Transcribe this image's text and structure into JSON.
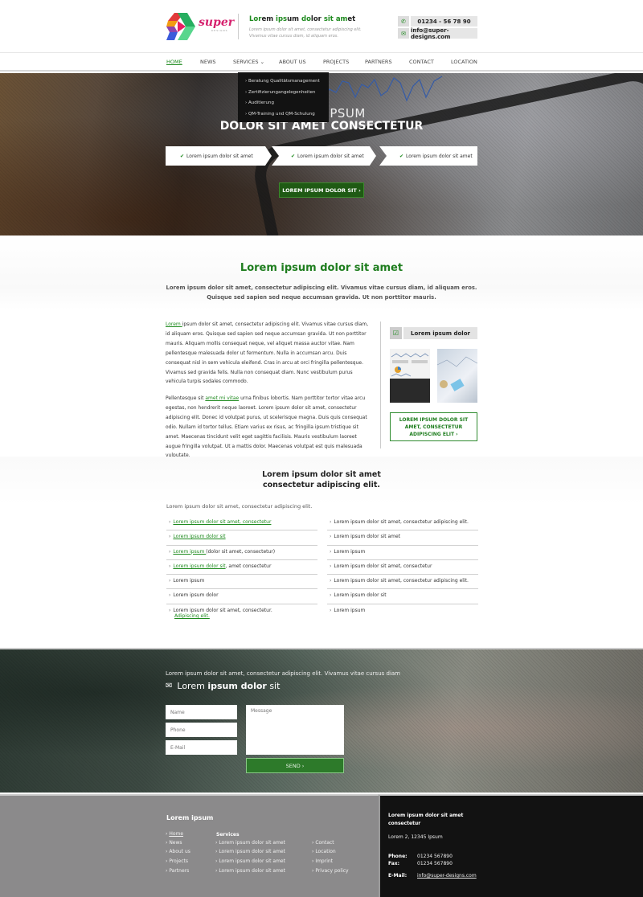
{
  "header": {
    "logo_text": "super",
    "logo_sub": "DESIGNS",
    "title_parts": [
      {
        "text": "Lor",
        "green": true
      },
      {
        "text": "em ",
        "green": false
      },
      {
        "text": "ips",
        "green": true
      },
      {
        "text": "um ",
        "green": false
      },
      {
        "text": "do",
        "green": true
      },
      {
        "text": "lor ",
        "green": false
      },
      {
        "text": "sit am",
        "green": true
      },
      {
        "text": "et",
        "green": false
      }
    ],
    "description": "Lorem ipsum dolor sit amet, consectetur adipiscing elit. Vivamus vitae cursus diam, id aliquam eros.",
    "phone": "01234 - 56 78 90",
    "email": "info@super-designs.com",
    "phone_icon": "phone-icon",
    "email_icon": "envelope-icon"
  },
  "nav": {
    "items": [
      "HOME",
      "NEWS",
      "SERVICES ⌄",
      "ABOUT US",
      "PROJECTS",
      "PARTNERS",
      "CONTACT",
      "LOCATION"
    ],
    "active": "HOME",
    "dropdown": [
      "› Beratung Qualitätsmanagement",
      "› Zertifizierungangelegenheiten",
      "› Auditierung",
      "› QM-Training und QM-Schulung"
    ]
  },
  "hero": {
    "title_line1": "LOREM IPSUM",
    "title_line2": "DOLOR SIT AMET CONSECTETUR",
    "steps": [
      "Lorem ipsum dolor sit amet",
      "Lorem ipsum dolor sit amet",
      "Lorem ipsum dolor sit amet"
    ],
    "check_glyph": "✔",
    "button_label": "LOREM IPSUM DOLOR SIT ›"
  },
  "intro": {
    "title": "Lorem ipsum dolor sit amet",
    "text": "Lorem ipsum dolor sit amet, consectetur adipiscing elit. Vivamus vitae cursus diam, id aliquam eros. Quisque sed sapien sed neque accumsan gravida. Ut non porttitor mauris."
  },
  "article": {
    "p1_link": "Lorem ",
    "p1_text": "ipsum dolor sit amet, consectetur adipiscing elit. Vivamus vitae cursus diam, id aliquam eros. Quisque sed sapien sed neque accumsan gravida. Ut non porttitor mauris. Aliquam mollis consequat neque, vel aliquet massa auctor vitae. Nam pellentesque malesuada dolor ut fermentum. Nulla in accumsan arcu. Duis consequat nisl in sem vehicula eleifend. Cras in arcu at orci fringilla pellentesque. Vivamus sed gravida felis. Nulla non consequat diam. Nunc vestibulum purus vehicula turpis sodales commodo.",
    "p2_before": "Pellentesque sit ",
    "p2_link": "amet mi vitae",
    "p2_after": " urna finibus lobortis. Nam porttitor tortor vitae arcu egestas, non hendrerit neque laoreet. Lorem ipsum dolor sit amet, consectetur adipiscing elit. Donec id volutpat purus, ut scelerisque magna. Duis quis consequat odio. Nullam id tortor tellus. Etiam varius ex risus, ac fringilla ipsum tristique sit amet. Maecenas tincidunt velit eget sagittis facilisis. Mauris vestibulum laoreet augue fringilla volutpat. Ut a mattis dolor. Maecenas volutpat est quis malesuada vulputate."
  },
  "sidebar": {
    "heading": "Lorem ipsum dolor",
    "check_glyph": "☑",
    "button_label": "LOREM IPSUM DOLOR SIT AMET, CONSECTETUR ADIPISCING ELIT ›"
  },
  "list_section": {
    "title_line1": "Lorem ipsum dolor sit amet",
    "title_line2": "consectetur adipiscing elit.",
    "intro": "Lorem ipsum dolor sit amet, consectetur adipiscing elit.",
    "left": [
      {
        "link": "Lorem ipsum dolor sit amet, consectetur",
        "text": ""
      },
      {
        "link": "Lorem ipsum dolor sit",
        "text": ""
      },
      {
        "link": "Lorem ipsum ",
        "text": " (dolor sit amet, consectetur)"
      },
      {
        "link": "Lorem ipsum dolor sit",
        "text": ", amet consectetur"
      },
      {
        "link": "",
        "text": "Lorem ipsum"
      },
      {
        "link": "",
        "text": "Lorem ipsum dolor"
      },
      {
        "link": "",
        "text": "Lorem ipsum dolor sit amet, consectetur.",
        "link2": "Adipiscing elit."
      }
    ],
    "right": [
      "Lorem ipsum dolor sit amet, consectetur adipiscing elit.",
      "Lorem ipsum dolor sit amet",
      "Lorem ipsum",
      "Lorem ipsum dolor sit amet, consectetur",
      "Lorem ipsum dolor sit amet, consectetur adipiscing elit.",
      "Lorem ipsum dolor sit",
      "Lorem ipsum"
    ]
  },
  "contact": {
    "lead": "Lorem ipsum dolor sit amet, consectetur adipiscing elit. Vivamus vitae cursus diam",
    "title_pre": "Lorem ",
    "title_bold": "ipsum dolor",
    "title_post": " sit",
    "name_placeholder": "Name",
    "phone_placeholder": "Phone",
    "email_placeholder": "E-Mail",
    "message_placeholder": "Message",
    "send_label": "SEND ›"
  },
  "footer": {
    "title": "Lorem ipsum",
    "nav": [
      "Home",
      "News",
      "About us",
      "Projects",
      "Partners"
    ],
    "services_heading": "Services",
    "services": [
      "Lorem ipsum dolor sit amet",
      "Lorem ipsum dolor sit amet",
      "Lorem ipsum dolor sit amet",
      "Lorem ipsum dolor sit amet"
    ],
    "links": [
      "Contact",
      "Location",
      "Imprint",
      "Privacy policy"
    ],
    "company_line1": "Lorem ipsum dolor sit amet",
    "company_line2": "consectetur",
    "address": "Lorem 2, 12345 Ipsum",
    "phone_label": "Phone:",
    "phone": "01234 567890",
    "fax_label": "Fax:",
    "fax": "01234 567890",
    "email_label": "E-Mail:",
    "email": "info@super-designs.com"
  },
  "colors": {
    "brand_green": "#1e8a1e",
    "dark_green_button": "#1f5a14",
    "logo_pink": "#d6216e",
    "footer_gray": "#8b8a8b",
    "footer_dark": "#121212"
  }
}
